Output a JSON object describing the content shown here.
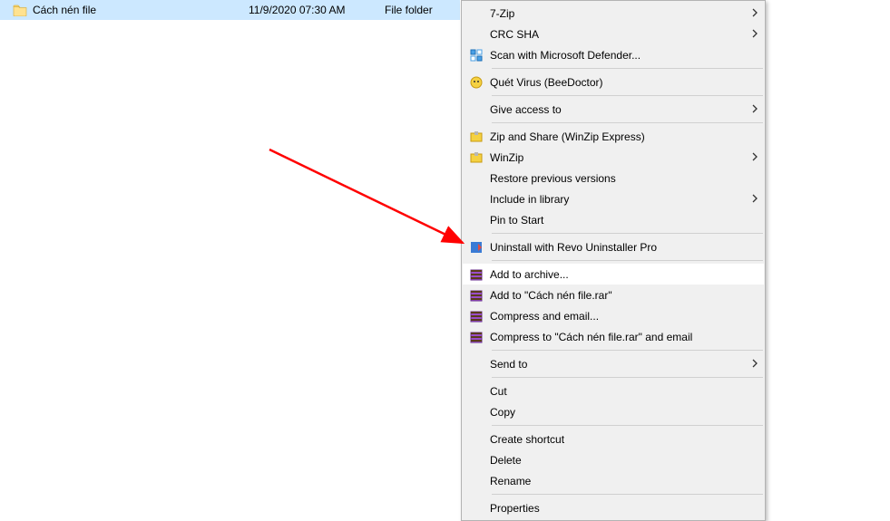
{
  "file": {
    "name": "Cách nén file",
    "date": "11/9/2020 07:30 AM",
    "type": "File folder"
  },
  "menu": {
    "sevenZip": "7-Zip",
    "crcSha": "CRC SHA",
    "defender": "Scan with Microsoft Defender...",
    "quetVirus": "Quét Virus (BeeDoctor)",
    "giveAccess": "Give access to",
    "zipAndShare": "Zip and Share (WinZip Express)",
    "winzip": "WinZip",
    "restorePrev": "Restore previous versions",
    "includeLib": "Include in library",
    "pinStart": "Pin to Start",
    "revoUninstall": "Uninstall with Revo Uninstaller Pro",
    "addArchive": "Add to archive...",
    "addToRar": "Add to \"Cách nén file.rar\"",
    "compressEmail": "Compress and email...",
    "compressRarEmail": "Compress to \"Cách nén file.rar\" and email",
    "sendTo": "Send to",
    "cut": "Cut",
    "copy": "Copy",
    "createShortcut": "Create shortcut",
    "delete": "Delete",
    "rename": "Rename",
    "properties": "Properties"
  }
}
